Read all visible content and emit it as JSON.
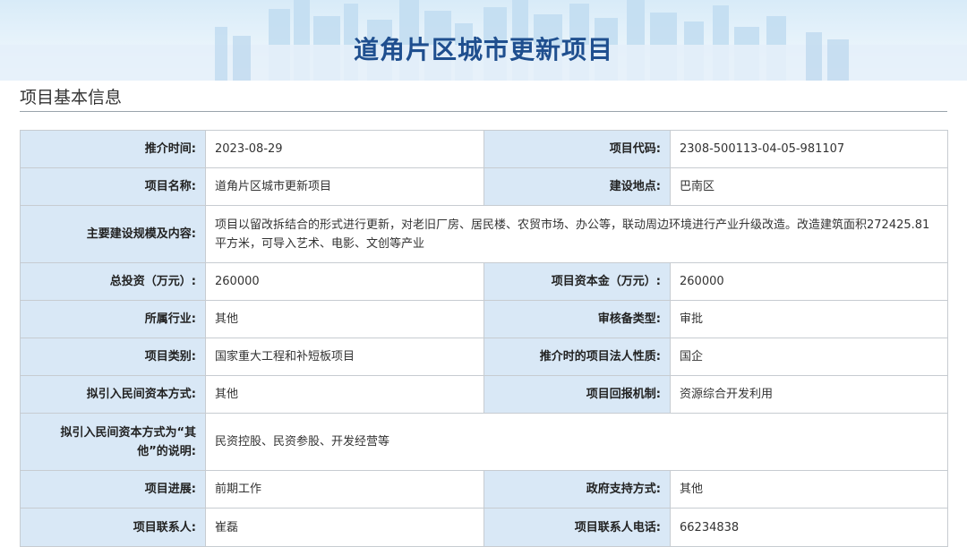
{
  "header": {
    "title": "道角片区城市更新项目"
  },
  "section": {
    "title": "项目基本信息"
  },
  "colors": {
    "accent": "#1f4f8f",
    "label_bg": "#d9e8f6",
    "border": "#c7ccd1"
  },
  "rows": [
    {
      "l1": "推介时间:",
      "v1": "2023-08-29",
      "l2": "项目代码:",
      "v2": "2308-500113-04-05-981107"
    },
    {
      "l1": "项目名称:",
      "v1": "道角片区城市更新项目",
      "l2": "建设地点:",
      "v2": "巴南区"
    },
    {
      "l1": "主要建设规模及内容:",
      "v1": "项目以留改拆结合的形式进行更新，对老旧厂房、居民楼、农贸市场、办公等，联动周边环境进行产业升级改造。改造建筑面积272425.81平方米，可导入艺术、电影、文创等产业"
    },
    {
      "l1": "总投资（万元）:",
      "v1": "260000",
      "l2": "项目资本金（万元）:",
      "v2": "260000"
    },
    {
      "l1": "所属行业:",
      "v1": "其他",
      "l2": "审核备类型:",
      "v2": "审批"
    },
    {
      "l1": "项目类别:",
      "v1": "国家重大工程和补短板项目",
      "l2": "推介时的项目法人性质:",
      "v2": "国企"
    },
    {
      "l1": "拟引入民间资本方式:",
      "v1": "其他",
      "l2": "项目回报机制:",
      "v2": "资源综合开发利用"
    },
    {
      "l1": "拟引入民间资本方式为“其他”的说明:",
      "v1": "民资控股、民资参股、开发经营等"
    },
    {
      "l1": "项目进展:",
      "v1": "前期工作",
      "l2": "政府支持方式:",
      "v2": "其他"
    },
    {
      "l1": "项目联系人:",
      "v1": "崔磊",
      "l2": "项目联系人电话:",
      "v2": "66234838"
    }
  ]
}
